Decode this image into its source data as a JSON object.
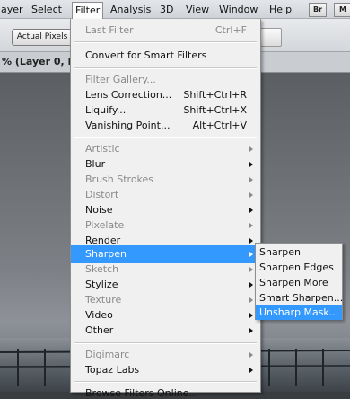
{
  "menubar": {
    "items": [
      {
        "label": "ayer"
      },
      {
        "label": "Select"
      },
      {
        "label": "Filter"
      },
      {
        "label": "Analysis"
      },
      {
        "label": "3D"
      },
      {
        "label": "View"
      },
      {
        "label": "Window"
      },
      {
        "label": "Help"
      }
    ],
    "bridge_label": "Br",
    "minibridge_label": "M"
  },
  "options_bar": {
    "actual_pixels_label": "Actual Pixels"
  },
  "document_tab": {
    "title": "% (Layer 0, RGB"
  },
  "filter_menu": {
    "items": [
      {
        "label": "Last Filter",
        "shortcut": "Ctrl+F",
        "disabled": true
      },
      {
        "label": "Convert for Smart Filters"
      },
      {
        "label": "Filter Gallery...",
        "disabled": true
      },
      {
        "label": "Lens Correction...",
        "shortcut": "Shift+Ctrl+R"
      },
      {
        "label": "Liquify...",
        "shortcut": "Shift+Ctrl+X"
      },
      {
        "label": "Vanishing Point...",
        "shortcut": "Alt+Ctrl+V"
      },
      {
        "label": "Artistic",
        "disabled": true,
        "submenu": true
      },
      {
        "label": "Blur",
        "submenu": true
      },
      {
        "label": "Brush Strokes",
        "disabled": true,
        "submenu": true
      },
      {
        "label": "Distort",
        "disabled": true,
        "submenu": true
      },
      {
        "label": "Noise",
        "submenu": true
      },
      {
        "label": "Pixelate",
        "disabled": true,
        "submenu": true
      },
      {
        "label": "Render",
        "submenu": true
      },
      {
        "label": "Sharpen",
        "submenu": true,
        "highlighted": true
      },
      {
        "label": "Sketch",
        "disabled": true,
        "submenu": true
      },
      {
        "label": "Stylize",
        "submenu": true
      },
      {
        "label": "Texture",
        "disabled": true,
        "submenu": true
      },
      {
        "label": "Video",
        "submenu": true
      },
      {
        "label": "Other",
        "submenu": true
      },
      {
        "label": "Digimarc",
        "disabled": true,
        "submenu": true
      },
      {
        "label": "Topaz Labs",
        "submenu": true
      },
      {
        "label": "Browse Filters Online..."
      }
    ]
  },
  "sharpen_submenu": {
    "items": [
      {
        "label": "Sharpen"
      },
      {
        "label": "Sharpen Edges"
      },
      {
        "label": "Sharpen More"
      },
      {
        "label": "Smart Sharpen..."
      },
      {
        "label": "Unsharp Mask...",
        "highlighted": true
      }
    ]
  },
  "colors": {
    "highlight": "#3399ff",
    "menu_bg": "#f0f0f0",
    "disabled_text": "#8a8a8a"
  }
}
